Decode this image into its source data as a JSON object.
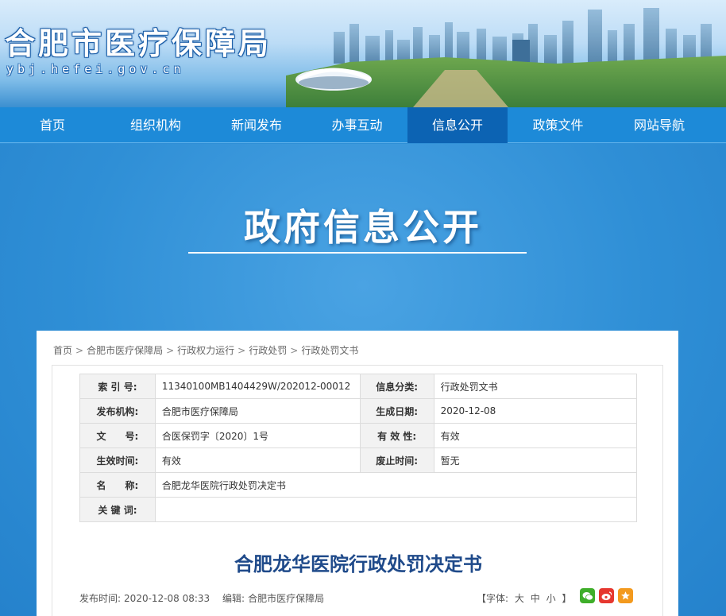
{
  "site": {
    "title": "合肥市医疗保障局",
    "domain": "ybj.hefei.gov.cn"
  },
  "nav": {
    "items": [
      {
        "label": "首页"
      },
      {
        "label": "组织机构"
      },
      {
        "label": "新闻发布"
      },
      {
        "label": "办事互动"
      },
      {
        "label": "信息公开",
        "active": true
      },
      {
        "label": "政策文件"
      },
      {
        "label": "网站导航"
      }
    ]
  },
  "hero": {
    "title": "政府信息公开"
  },
  "breadcrumb": [
    "首页",
    "合肥市医疗保障局",
    "行政权力运行",
    "行政处罚",
    "行政处罚文书"
  ],
  "meta": {
    "index_label": "索 引 号:",
    "index_value": "11340100MB1404429W/202012-00012",
    "category_label": "信息分类:",
    "category_value": "行政处罚文书",
    "publisher_label": "发布机构:",
    "publisher_value": "合肥市医疗保障局",
    "created_label": "生成日期:",
    "created_value": "2020-12-08",
    "docno_label": "文　　号:",
    "docno_value": "合医保罚字〔2020〕1号",
    "validity_label": "有 效 性:",
    "validity_value": "有效",
    "effective_label": "生效时间:",
    "effective_value": "有效",
    "repeal_label": "废止时间:",
    "repeal_value": "暂无",
    "name_label": "名　　称:",
    "name_value": "合肥龙华医院行政处罚决定书",
    "keywords_label": "关 键 词:",
    "keywords_value": ""
  },
  "document": {
    "title": "合肥龙华医院行政处罚决定书",
    "publish_time_label": "发布时间:",
    "publish_time": "2020-12-08 08:33",
    "editor_label": "编辑:",
    "editor": "合肥市医疗保障局",
    "font_label": "【字体:",
    "font_large": "大",
    "font_medium": "中",
    "font_small": "小",
    "font_close": "】"
  },
  "share": {
    "icons": [
      "wechat-icon",
      "weibo-icon",
      "favorite-icon"
    ],
    "colors": {
      "wechat": "#3fae2a",
      "weibo": "#e6372f",
      "favorite": "#f39a1e"
    }
  }
}
